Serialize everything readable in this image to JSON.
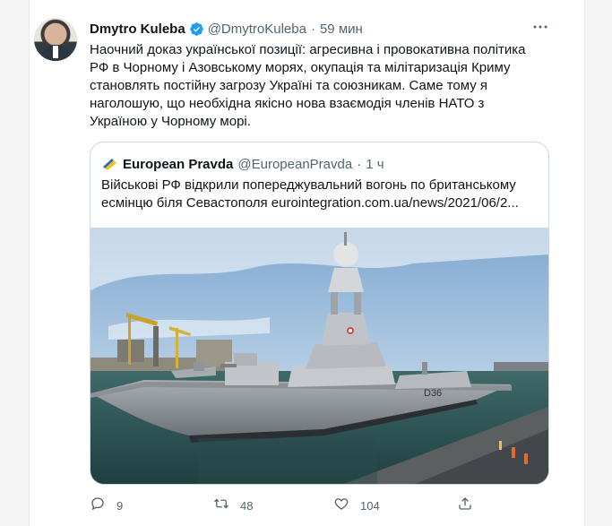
{
  "tweet": {
    "author_name": "Dmytro Kuleba",
    "author_handle": "@DmytroKuleba",
    "separator": "·",
    "time": "59 мин",
    "text": "Наочний доказ української позиції: агресивна і провокативна політика\nРФ в Чорному і Азовському морях, окупація та мілітаризація Криму\nстановлять постійну загрозу Україні та союзникам. Саме тому я\nнаголошую, що необхідна якісно нова взаємодія членів НАТО з\nУкраїною у Чорному морі."
  },
  "quote": {
    "author_name": "European Pravda",
    "author_handle": "@EuropeanPravda",
    "separator": "·",
    "time": "1 ч",
    "text": "Військові РФ відкрили попереджувальний вогонь по британському\nесмінцю біля Севастополя eurointegration.com.ua/news/2021/06/2...",
    "hull_number": "D36"
  },
  "actions": {
    "reply_count": "9",
    "retweet_count": "48",
    "like_count": "104"
  },
  "icons": {
    "verified": "verified-badge-icon",
    "more": "more-dots-icon",
    "reply": "reply-icon",
    "retweet": "retweet-icon",
    "like": "heart-icon",
    "share": "share-icon"
  },
  "colors": {
    "accent": "#1d9bf0",
    "text": "#0f1419",
    "secondary": "#536471",
    "border": "#cfd9de"
  }
}
